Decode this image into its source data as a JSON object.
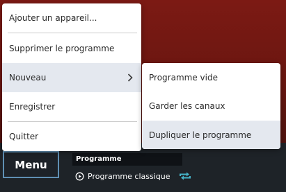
{
  "main_menu": {
    "items": [
      {
        "label": "Ajouter un appareil..."
      },
      {
        "label": "Supprimer le programme"
      },
      {
        "label": "Nouveau"
      },
      {
        "label": "Enregistrer"
      },
      {
        "label": "Quitter"
      }
    ]
  },
  "submenu": {
    "items": [
      {
        "label": "Programme vide"
      },
      {
        "label": "Garder les canaux"
      },
      {
        "label": "Dupliquer le programme"
      }
    ]
  },
  "bottom_bar": {
    "menu_label": "Menu",
    "program_header": "Programme",
    "program_name": "Programme classique"
  },
  "icons": {
    "chevron": "chevron-right-icon",
    "play": "play-circle-icon",
    "sync": "sync-icon"
  },
  "colors": {
    "accent": "#5f8fb3",
    "sync_icon": "#45b3c7",
    "background_red": "#6e1a12",
    "menu_highlight": "#e4e8ef"
  }
}
